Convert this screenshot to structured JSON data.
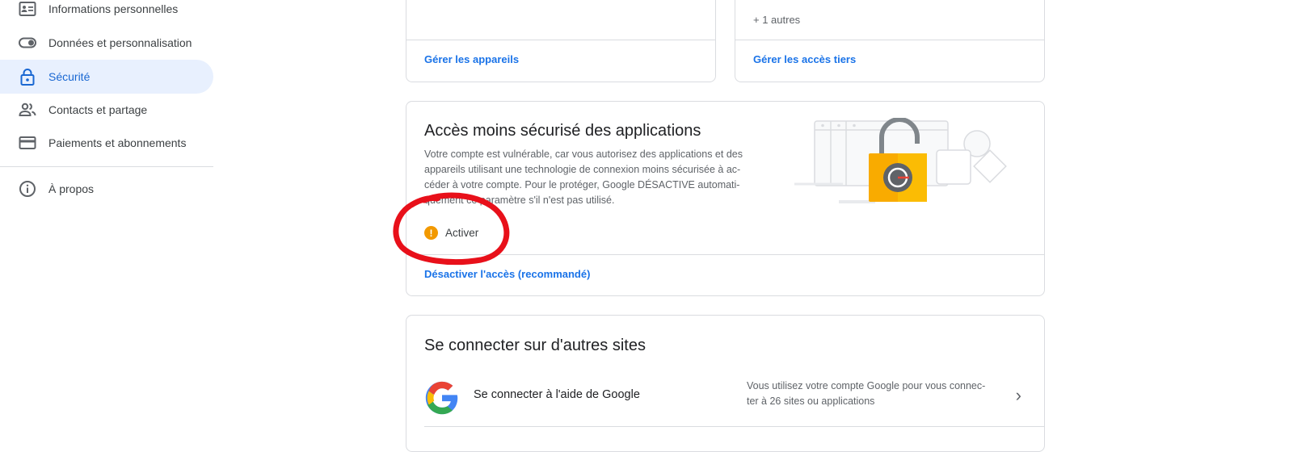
{
  "sidebar": {
    "items": [
      {
        "label": "Informations personnelles",
        "icon": "person-card-icon"
      },
      {
        "label": "Données et personnalisation",
        "icon": "toggle-icon"
      },
      {
        "label": "Sécurité",
        "icon": "lock-icon",
        "active": true
      },
      {
        "label": "Contacts et partage",
        "icon": "people-icon"
      },
      {
        "label": "Paiements et abonnements",
        "icon": "credit-card-icon"
      },
      {
        "label": "À propos",
        "icon": "info-icon"
      }
    ]
  },
  "devices_card": {
    "link": "Gérer les appareils"
  },
  "third_party_card": {
    "more": "+ 1 autres",
    "link": "Gérer les accès tiers"
  },
  "less_secure_card": {
    "title": "Accès moins sécurisé des applications",
    "desc_lines": [
      "Votre compte est vulnérable, car vous autorisez des applications et des",
      "appareils utilisant une technologie de connexion moins sécurisée à ac-",
      "céder à votre compte. Pour le protéger, Google DÉSACTIVE automati-",
      "quement ce paramètre s'il n'est pas utilisé."
    ],
    "status": "Activer",
    "link": "Désactiver l'accès (recommandé)"
  },
  "other_sites_card": {
    "title": "Se connecter sur d'autres sites",
    "row_label": "Se connecter à l'aide de Google",
    "row_desc_lines": [
      "Vous utilisez votre compte Google pour vous connec-",
      "ter à 26 sites ou applications"
    ]
  },
  "colors": {
    "accent": "#1a73e8",
    "active_bg": "#e8f0fe",
    "warning": "#f29900",
    "annotation": "#e8101a"
  }
}
